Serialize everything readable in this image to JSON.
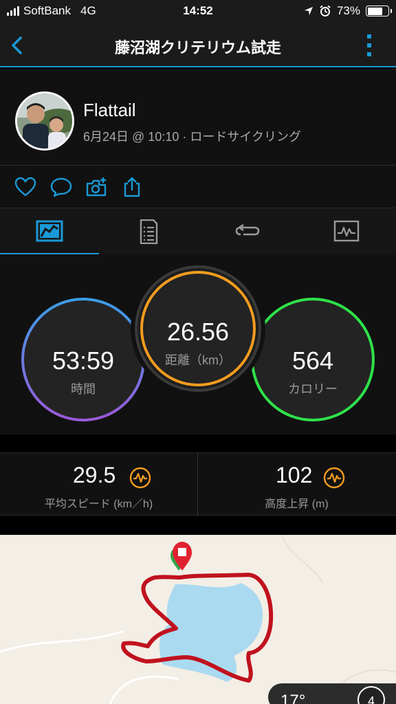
{
  "status_bar": {
    "carrier": "SoftBank",
    "network": "4G",
    "time": "14:52",
    "battery_percent": "73%",
    "battery_level": 0.73,
    "icons": [
      "signal-icon",
      "location-arrow-icon",
      "alarm-icon",
      "battery-icon"
    ]
  },
  "header": {
    "title": "藤沼湖クリテリウム試走",
    "back_icon": "chevron-left-icon",
    "menu_icon": "vertical-ellipsis-icon"
  },
  "activity": {
    "user_name": "Flattail",
    "meta": "6月24日 @ 10:10 · ロードサイクリング"
  },
  "actions": [
    "heart-icon",
    "comment-icon",
    "camera-add-icon",
    "share-icon"
  ],
  "tabs": [
    {
      "icon": "overview-icon",
      "active": true
    },
    {
      "icon": "details-list-icon",
      "active": false
    },
    {
      "icon": "laps-icon",
      "active": false
    },
    {
      "icon": "chart-icon",
      "active": false
    }
  ],
  "summary": {
    "time": {
      "value": "53:59",
      "label": "時間"
    },
    "distance": {
      "value": "26.56",
      "label": "距離（km）"
    },
    "calories": {
      "value": "564",
      "label": "カロリー"
    }
  },
  "stats": {
    "avg_speed": {
      "value": "29.5",
      "label": "平均スピード (km／h)"
    },
    "elevation_gain": {
      "value": "102",
      "label": "高度上昇 (m)"
    }
  },
  "map": {
    "weather_temp": "17°",
    "wind_value": "4"
  },
  "colors": {
    "accent": "#1a9ad7",
    "time_ring": "#4a90e2",
    "distance_ring": "#f39c1f",
    "calories_ring": "#2ee24a",
    "route": "#c0121e",
    "lake": "#aadaf0"
  }
}
